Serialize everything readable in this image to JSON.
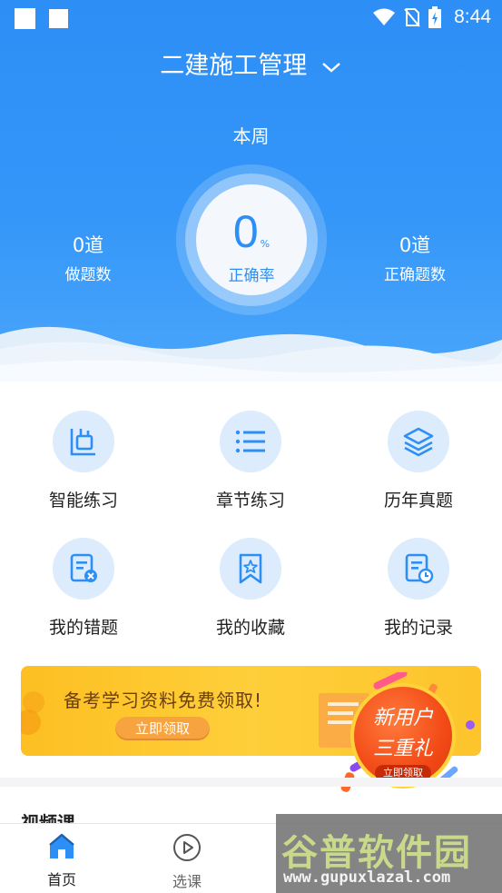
{
  "status_bar": {
    "time": "8:44"
  },
  "header": {
    "title": "二建施工管理",
    "period": "本周",
    "accuracy_value": "0",
    "accuracy_unit": "%",
    "accuracy_label": "正确率",
    "left_stat": {
      "value": "0道",
      "label": "做题数"
    },
    "right_stat": {
      "value": "0道",
      "label": "正确题数"
    }
  },
  "grid": [
    {
      "label": "智能练习",
      "icon": "smart-practice-icon"
    },
    {
      "label": "章节练习",
      "icon": "list-icon"
    },
    {
      "label": "历年真题",
      "icon": "layers-icon"
    },
    {
      "label": "我的错题",
      "icon": "wrong-questions-icon"
    },
    {
      "label": "我的收藏",
      "icon": "bookmark-star-icon"
    },
    {
      "label": "我的记录",
      "icon": "record-clock-icon"
    }
  ],
  "banner": {
    "text": "备考学习资料免费领取!",
    "button": "立即领取",
    "badge_line1": "新用户",
    "badge_line2": "三重礼",
    "badge_button": "立即领取",
    "slides": 2,
    "active_slide": 1
  },
  "section": {
    "title": "视频课"
  },
  "tabs": [
    {
      "label": "首页",
      "icon": "home-icon",
      "active": true
    },
    {
      "label": "选课",
      "icon": "play-circle-icon",
      "active": false
    }
  ],
  "watermark": {
    "title": "谷普软件园",
    "url": "www.gupuxlazal.com"
  },
  "colors": {
    "primary": "#2d8ff6",
    "banner": "#fdc42c",
    "badge": "#f24a16",
    "icon_bg": "#dcecfd"
  }
}
